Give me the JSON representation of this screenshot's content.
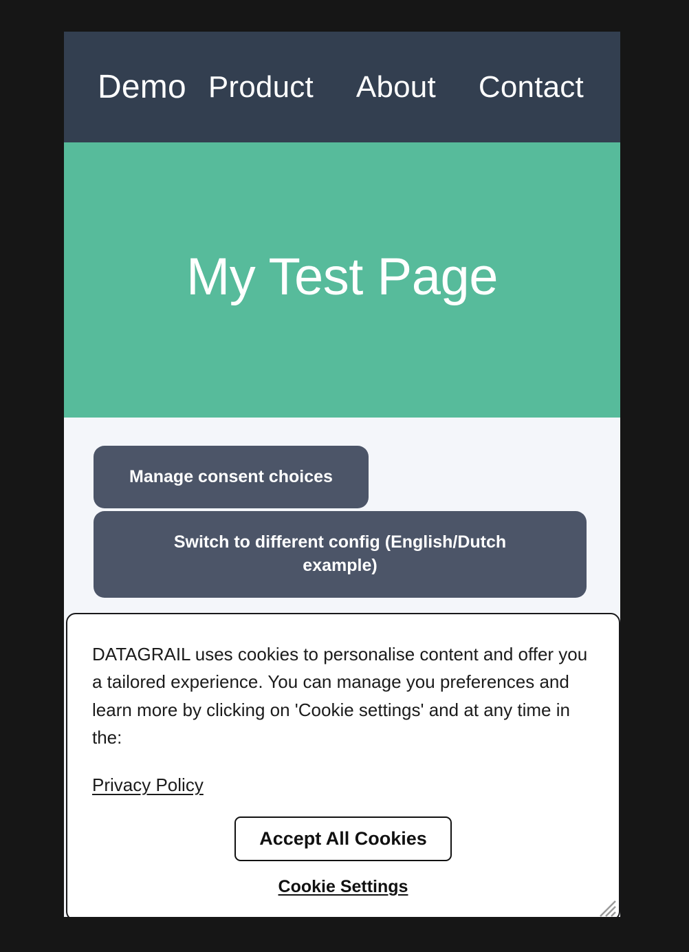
{
  "colors": {
    "outer_background": "#161616",
    "navbar_background": "#333f50",
    "hero_background": "#57bb9b",
    "page_background": "#f4f6fa",
    "action_button_background": "#4c5568",
    "banner_background": "#ffffff",
    "banner_border": "#18181a",
    "text_dark": "#1b1b1b",
    "text_light": "#ffffff"
  },
  "navbar": {
    "brand": "Demo",
    "items": [
      {
        "label": "Product"
      },
      {
        "label": "About"
      },
      {
        "label": "Contact"
      }
    ]
  },
  "hero": {
    "title": "My Test Page"
  },
  "actions": {
    "manage_consent_label": "Manage consent choices",
    "switch_config_label": "Switch to different config (English/Dutch example)"
  },
  "cookie_banner": {
    "body": "DATAGRAIL uses cookies to personalise content and offer you a tailored experience. You can manage you preferences and learn more by clicking on 'Cookie settings' and at any time in the:",
    "privacy_policy_label": "Privacy Policy",
    "accept_all_label": "Accept All Cookies",
    "cookie_settings_label": "Cookie Settings",
    "resize_grip": "resize-grip-icon"
  }
}
